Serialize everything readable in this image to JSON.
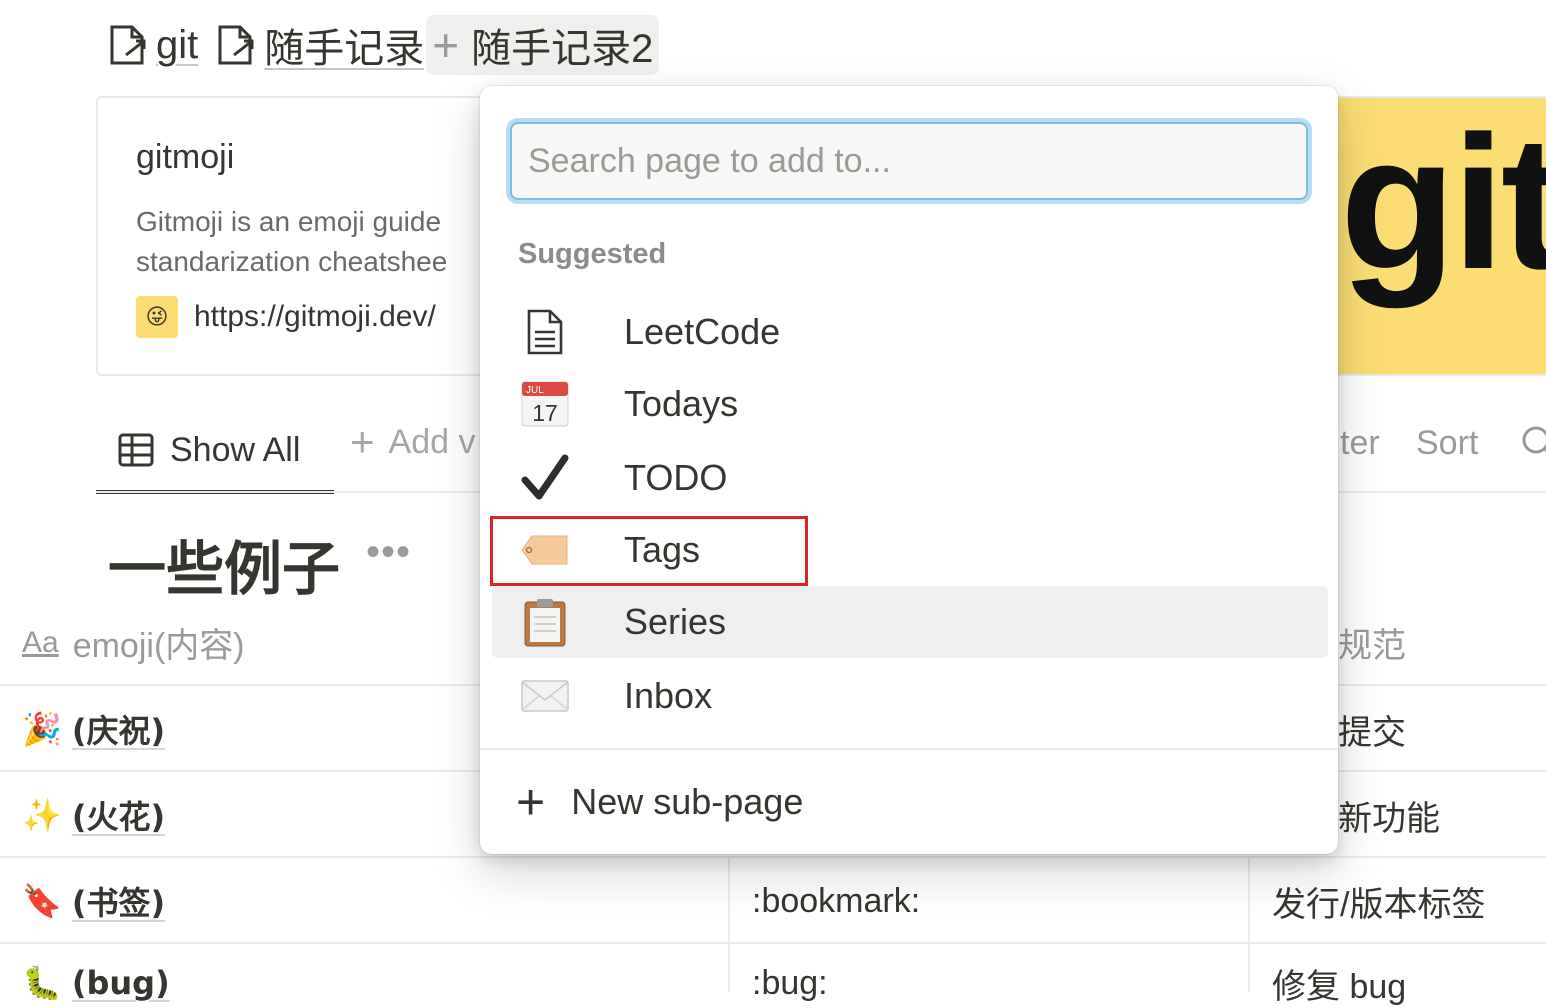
{
  "links": [
    {
      "label": "git"
    },
    {
      "label": "随手记录"
    }
  ],
  "add_chip": {
    "label": "随手记录2",
    "icon": "plus-icon"
  },
  "bookmark": {
    "title": "gitmoji",
    "description_line1": "Gitmoji is an emoji guide",
    "description_line2": "standarization cheatshee",
    "url": "https://gitmoji.dev/",
    "favicon": "😜",
    "cover_text": "git",
    "cover_color": "#fbdd73"
  },
  "view_tabs": {
    "active": "Show All",
    "add": "Add v",
    "filter": "ter",
    "sort": "Sort"
  },
  "database": {
    "title": "一些例子",
    "more": "•••",
    "columns": [
      {
        "label": "emoji(内容)",
        "icon": "Aa"
      },
      {
        "label": "规范"
      }
    ],
    "rows": [
      {
        "emoji": "🎉",
        "name": "(庆祝)",
        "code": "",
        "desc": "提交"
      },
      {
        "emoji": "✨",
        "name": "(火花)",
        "code": "",
        "desc": "新功能"
      },
      {
        "emoji": "🔖",
        "name": "(书签)",
        "code": ":bookmark:",
        "desc": "发行/版本标签"
      },
      {
        "emoji": "🐛",
        "name": "(bug)",
        "code": ":bug:",
        "desc": "修复 bug"
      }
    ]
  },
  "popup": {
    "search_placeholder": "Search page to add to...",
    "suggested_header": "Suggested",
    "items": [
      {
        "label": "LeetCode",
        "icon": "document-icon"
      },
      {
        "label": "Todays",
        "icon": "calendar-icon",
        "calendar_month": "JUL",
        "calendar_day": "17"
      },
      {
        "label": "TODO",
        "icon": "checkmark-icon"
      },
      {
        "label": "Tags",
        "icon": "tag-icon"
      },
      {
        "label": "Series",
        "icon": "clipboard-icon"
      },
      {
        "label": "Inbox",
        "icon": "envelope-icon"
      }
    ],
    "new_subpage": "New sub-page",
    "highlight_color": "#d9232d",
    "focus_color": "#7dbce3"
  }
}
